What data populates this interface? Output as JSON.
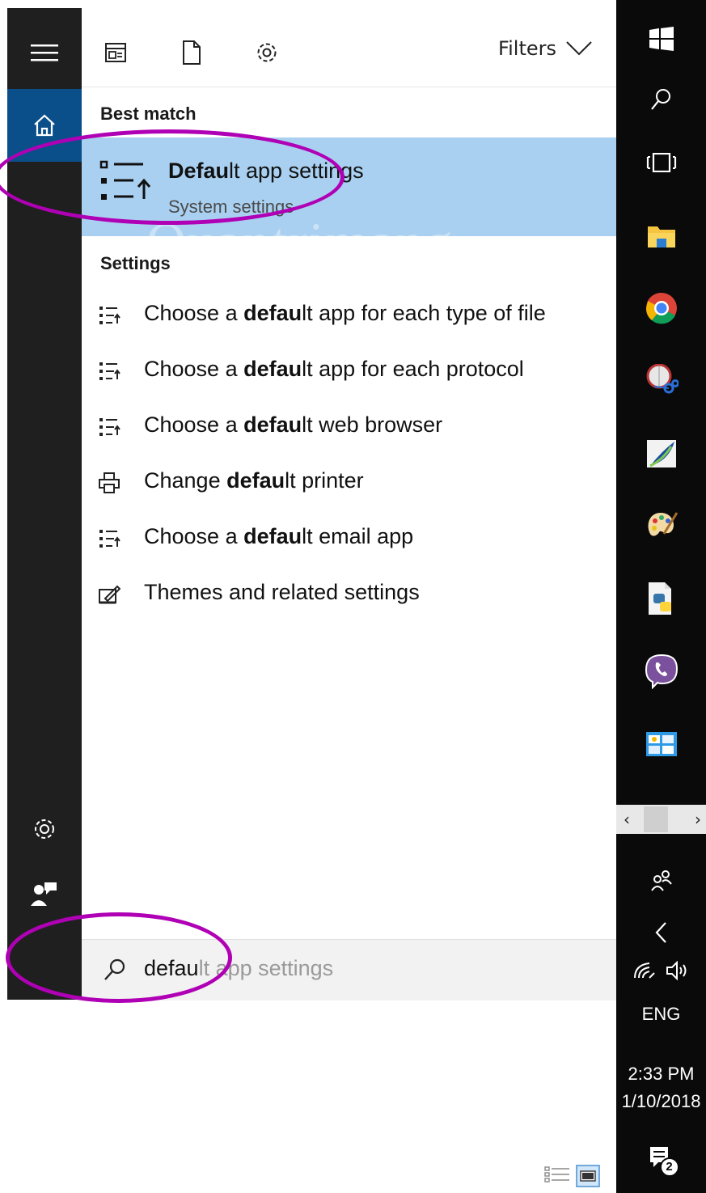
{
  "toolbar": {
    "filters_label": "Filters"
  },
  "best_match": {
    "section_label": "Best match",
    "title_bold": "Defau",
    "title_rest": "lt app settings",
    "subtitle": "System settings"
  },
  "settings": {
    "section_label": "Settings",
    "items": [
      {
        "pre": "Choose a ",
        "bold": "defau",
        "post": "lt app for each type of file",
        "icon": "list-settings-icon"
      },
      {
        "pre": "Choose a ",
        "bold": "defau",
        "post": "lt app for each protocol",
        "icon": "list-settings-icon"
      },
      {
        "pre": "Choose a ",
        "bold": "defau",
        "post": "lt web browser",
        "icon": "list-settings-icon"
      },
      {
        "pre": "Change ",
        "bold": "defau",
        "post": "lt printer",
        "icon": "printer-icon"
      },
      {
        "pre": "Choose a ",
        "bold": "defau",
        "post": "lt email app",
        "icon": "list-settings-icon"
      },
      {
        "pre": "",
        "bold": "",
        "post": "Themes and related settings",
        "icon": "themes-icon"
      }
    ]
  },
  "search": {
    "typed": "defau",
    "suggestion": "lt app settings"
  },
  "watermark": "Quantrimang",
  "taskbar": {
    "language": "ENG",
    "time": "2:33 PM",
    "date": "1/10/2018",
    "notification_count": "2"
  },
  "colors": {
    "accent": "#0a4f8a",
    "highlight": "#a9d0f0",
    "annotation": "#b000b5",
    "rail": "#1f1f1f",
    "taskbar": "#0a0a0a"
  }
}
